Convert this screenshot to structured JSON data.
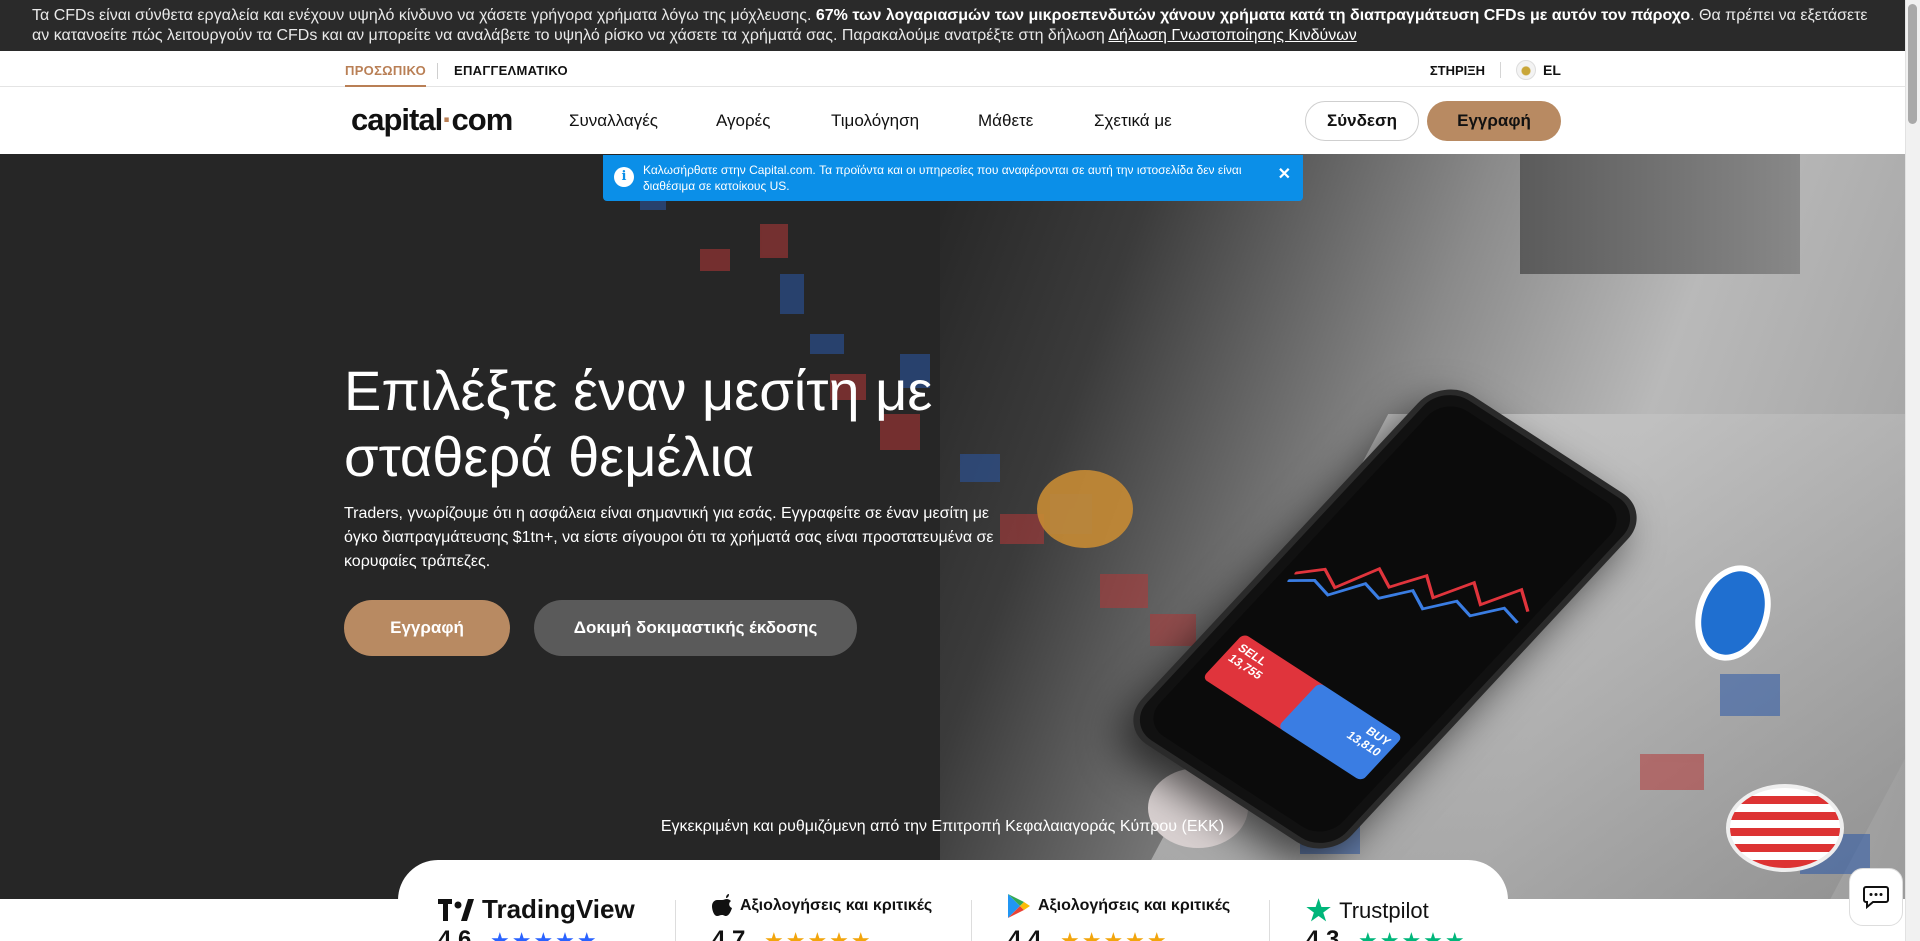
{
  "risk_banner": {
    "text_start": "Τα CFDs είναι σύνθετα εργαλεία και ενέχουν υψηλό κίνδυνο να χάσετε γρήγορα χρήματα λόγω της μόχλευσης. ",
    "text_bold": "67% των λογαριασμών των μικροεπενδυτών χάνουν χρήματα κατά τη διαπραγμάτευση CFDs με αυτόν τον πάροχο",
    "text_end": ". Θα πρέπει να εξετάσετε αν κατανοείτε πώς λειτουργούν τα CFDs και αν μπορείτε να αναλάβετε το υψηλό ρίσκο να χάσετε τα χρήματά σας. Παρακαλούμε ανατρέξτε στη δήλωση ",
    "link": "Δήλωση Γνωστοποίησης Κινδύνων"
  },
  "subnav": {
    "personal": "ΠΡΟΣΩΠΙΚΟ",
    "professional": "ΕΠΑΓΓΕΛΜΑΤΙΚΟ",
    "support": "ΣΤΗΡΙΞΗ",
    "language": "EL"
  },
  "nav": {
    "logo_a": "capital",
    "logo_dot": "·",
    "logo_b": "com",
    "items": [
      "Συναλλαγές",
      "Αγορές",
      "Τιμολόγηση",
      "Μάθετε",
      "Σχετικά με"
    ],
    "login": "Σύνδεση",
    "signup": "Εγγραφή"
  },
  "notice": {
    "text": "Καλωσήρθατε στην Capital.com. Τα προϊόντα και οι υπηρεσίες που αναφέρονται σε αυτή την ιστοσελίδα δεν είναι διαθέσιμα σε κατοίκους US.",
    "info_glyph": "i",
    "close_glyph": "✕"
  },
  "hero": {
    "headline": "Επιλέξτε έναν μεσίτη με σταθερά θεμέλια",
    "subtitle": "Traders, γνωρίζουμε ότι η ασφάλεια είναι σημαντική για εσάς. Εγγραφείτε σε έναν μεσίτη με όγκο διαπραγμάτευσης $1tn+, να είστε σίγουροι ότι τα χρήματά σας είναι προστατευμένα σε κορυφαίες τράπεζες.",
    "signup": "Εγγραφή",
    "demo": "Δοκιμή δοκιμαστικής έκδοσης",
    "regulated": "Εγκεκριμένη και ρυθμιζόμενη από την Επιτροπή Κεφαλαιαγοράς Κύπρου (ΕΚΚ)"
  },
  "phone": {
    "sell_label": "SELL",
    "sell_price": "13,755",
    "buy_label": "BUY",
    "buy_price": "13,810"
  },
  "ratings": {
    "tradingview": "TradingView",
    "apple": "Αξιολογήσεις και κριτικές",
    "google": "Αξιολογήσεις και κριτικές",
    "trustpilot": "Trustpilot",
    "tv_score": "4.6",
    "apple_score": "4.7",
    "google_score": "4.4",
    "tp_score": "4.3",
    "stars": "★★★★★"
  },
  "colors": {
    "accent": "#b88a62",
    "notice": "#0b8fe8",
    "banner": "#2a2a2a"
  },
  "icons": {
    "info": "info-icon",
    "close": "close-icon",
    "chat": "chat-icon",
    "apple": "apple-icon",
    "google_play": "google-play-icon",
    "trustpilot": "trustpilot-star-icon"
  }
}
